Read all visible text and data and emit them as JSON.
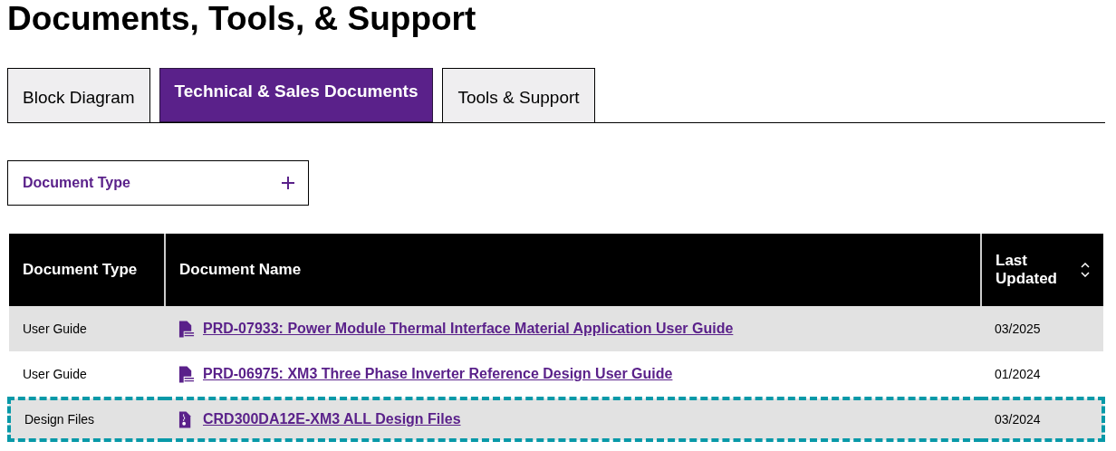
{
  "heading": "Documents, Tools, & Support",
  "tabs": [
    {
      "label": "Block Diagram",
      "selected": false
    },
    {
      "label": "Technical & Sales Documents",
      "selected": true
    },
    {
      "label": "Tools & Support",
      "selected": false
    }
  ],
  "filter": {
    "label": "Document Type",
    "expanded": false
  },
  "table": {
    "columns": [
      {
        "label": "Document Type",
        "sortable": false
      },
      {
        "label": "Document Name",
        "sortable": false
      },
      {
        "label": "Last Updated",
        "sortable": true
      }
    ],
    "rows": [
      {
        "type": "User Guide",
        "kind": "pdf",
        "name": "PRD-07933: Power Module Thermal Interface Material Application User Guide",
        "updated": "03/2025",
        "focused": false
      },
      {
        "type": "User Guide",
        "kind": "pdf",
        "name": "PRD-06975: XM3 Three Phase Inverter Reference Design User Guide",
        "updated": "01/2024",
        "focused": false
      },
      {
        "type": "Design Files",
        "kind": "zip",
        "name": "CRD300DA12E-XM3 ALL Design Files",
        "updated": "03/2024",
        "focused": true
      }
    ]
  }
}
